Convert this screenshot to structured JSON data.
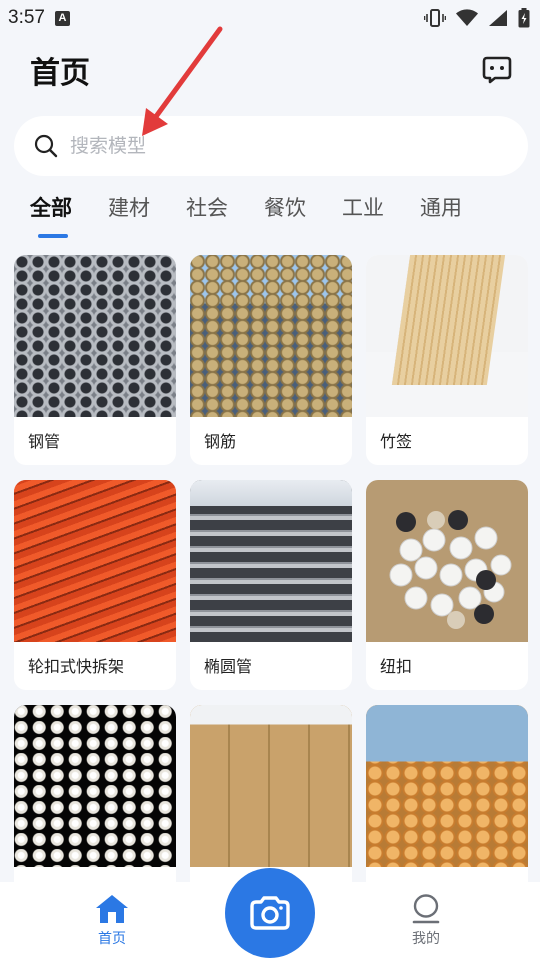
{
  "status_bar": {
    "time": "3:57",
    "app_icon": "A",
    "icons": [
      "vibrate-icon",
      "wifi-icon",
      "signal-icon",
      "battery-icon"
    ]
  },
  "header": {
    "title": "首页",
    "message_icon": "message-icon"
  },
  "search": {
    "placeholder": "搜索模型",
    "icon": "search-icon"
  },
  "tabs": [
    {
      "label": "全部",
      "active": true
    },
    {
      "label": "建材",
      "active": false
    },
    {
      "label": "社会",
      "active": false
    },
    {
      "label": "餐饮",
      "active": false
    },
    {
      "label": "工业",
      "active": false
    },
    {
      "label": "通用",
      "active": false
    }
  ],
  "models": [
    {
      "label": "钢管"
    },
    {
      "label": "钢筋"
    },
    {
      "label": "竹签"
    },
    {
      "label": "轮扣式快拆架"
    },
    {
      "label": "椭圆管"
    },
    {
      "label": "纽扣"
    },
    {
      "label": ""
    },
    {
      "label": ""
    },
    {
      "label": ""
    }
  ],
  "bottom_nav": {
    "home_label": "首页",
    "camera_icon": "camera-icon",
    "mine_label": "我的"
  },
  "colors": {
    "accent": "#2b78e4",
    "background": "#f4f6fa",
    "annotation_arrow": "#e23b3b"
  }
}
